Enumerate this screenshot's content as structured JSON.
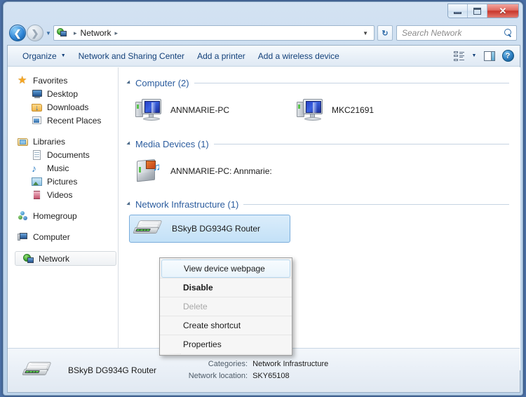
{
  "window": {
    "titlebar": {
      "minimize_label": "Minimize",
      "maximize_label": "Maximize",
      "close_label": "Close"
    }
  },
  "address_bar": {
    "back_label": "Back",
    "forward_label": "Forward",
    "history_label": "Recent pages",
    "breadcrumb": [
      "Network"
    ],
    "breadcrumb_sep": "▸",
    "dropdown_caret": "▼",
    "refresh_label": "↻",
    "search": {
      "placeholder": "Search Network",
      "value": ""
    }
  },
  "toolbar": {
    "organize": "Organize",
    "organize_caret": "▼",
    "network_sharing_center": "Network and Sharing Center",
    "add_printer": "Add a printer",
    "add_wireless_device": "Add a wireless device",
    "view_caret": "▼",
    "help_glyph": "?"
  },
  "sidebar": {
    "groups": [
      {
        "label": "Favorites",
        "icon": "star-icon",
        "children": [
          {
            "label": "Desktop",
            "icon": "desktop-icon"
          },
          {
            "label": "Downloads",
            "icon": "downloads-icon"
          },
          {
            "label": "Recent Places",
            "icon": "recent-places-icon"
          }
        ]
      },
      {
        "label": "Libraries",
        "icon": "libraries-icon",
        "children": [
          {
            "label": "Documents",
            "icon": "documents-icon"
          },
          {
            "label": "Music",
            "icon": "music-icon"
          },
          {
            "label": "Pictures",
            "icon": "pictures-icon"
          },
          {
            "label": "Videos",
            "icon": "videos-icon"
          }
        ]
      },
      {
        "label": "Homegroup",
        "icon": "homegroup-icon",
        "children": []
      },
      {
        "label": "Computer",
        "icon": "computer-icon",
        "children": []
      },
      {
        "label": "Network",
        "icon": "network-icon",
        "children": [],
        "selected": true
      }
    ]
  },
  "content": {
    "groups": [
      {
        "title": "Computer (2)",
        "items": [
          {
            "label": "ANNMARIE-PC",
            "icon": "computer-device-icon"
          },
          {
            "label": "MKC21691",
            "icon": "computer-device-icon"
          }
        ]
      },
      {
        "title": "Media Devices (1)",
        "items": [
          {
            "label": "ANNMARIE-PC: Annmarie:",
            "icon": "media-device-icon"
          }
        ]
      },
      {
        "title": "Network Infrastructure (1)",
        "items": [
          {
            "label": "BSkyB DG934G Router",
            "icon": "router-icon",
            "selected": true
          }
        ]
      }
    ]
  },
  "context_menu": {
    "items": [
      {
        "label": "View device webpage",
        "state": "hover"
      },
      {
        "label": "Disable",
        "state": "default"
      },
      {
        "label": "Delete",
        "state": "disabled"
      },
      {
        "label": "Create shortcut",
        "state": "normal"
      },
      {
        "label": "Properties",
        "state": "normal"
      }
    ]
  },
  "details_pane": {
    "title": "BSkyB DG934G Router",
    "icon": "router-icon",
    "fields": [
      {
        "key": "Categories:",
        "value": "Network Infrastructure"
      },
      {
        "key": "Network location:",
        "value": "SKY65108"
      }
    ]
  },
  "colors": {
    "accent_blue": "#2b5c9e",
    "selection_blue": "#c3e1f7",
    "close_red": "#c8372c",
    "frame_blue": "#bcd3ea"
  }
}
